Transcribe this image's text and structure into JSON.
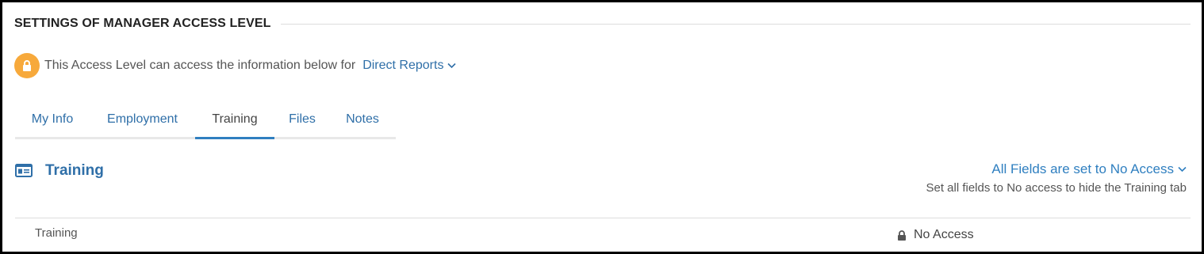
{
  "header": {
    "title": "SETTINGS OF MANAGER ACCESS LEVEL"
  },
  "access": {
    "icon": "lock-icon",
    "text": "This Access Level can access the information below for",
    "scope": "Direct Reports"
  },
  "tabs": [
    {
      "label": "My Info",
      "active": false
    },
    {
      "label": "Employment",
      "active": false
    },
    {
      "label": "Training",
      "active": true
    },
    {
      "label": "Files",
      "active": false
    },
    {
      "label": "Notes",
      "active": false
    }
  ],
  "section": {
    "icon": "id-card-icon",
    "title": "Training",
    "all_fields_label": "All Fields are set to No Access",
    "all_fields_hint": "Set all fields to No access to hide the Training tab"
  },
  "fields": [
    {
      "name": "Training",
      "access": "No Access",
      "icon": "lock-icon"
    }
  ],
  "colors": {
    "accent": "#2f6fa8",
    "tab_underline": "#2f7fc0",
    "lock_badge": "#f7a93b"
  }
}
